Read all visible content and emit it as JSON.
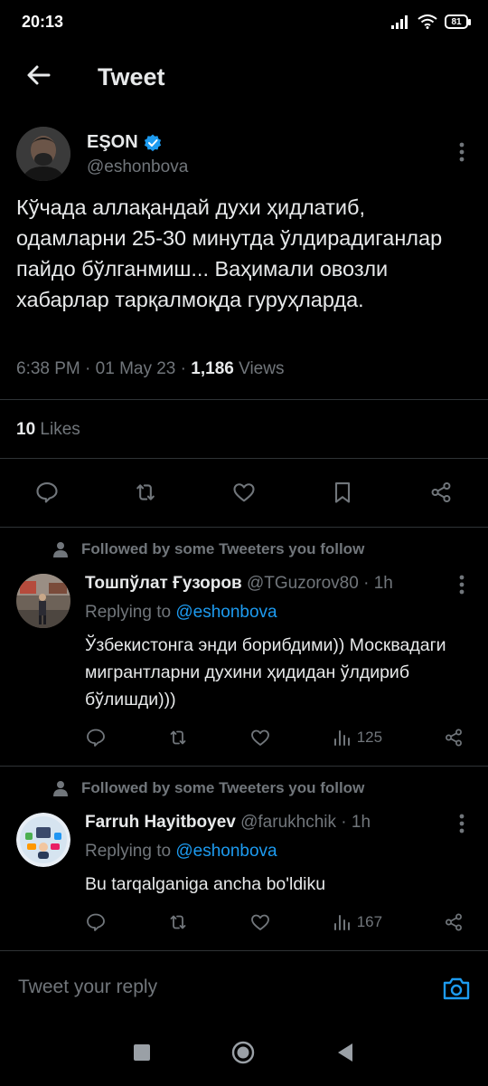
{
  "status_bar": {
    "time": "20:13",
    "battery": "81"
  },
  "header": {
    "title": "Tweet"
  },
  "tweet": {
    "author_name": "EŞON",
    "author_handle": "@eshonbova",
    "text": "Кўчада аллақандай духи ҳидлатиб, одамларни 25-30 минутда ўлдирадиганлар пайдо бўлганмиш... Ваҳимали овозли хабарлар тарқалмоқда гуруҳларда.",
    "time": "6:38 PM",
    "date": "01 May 23",
    "views_count": "1,186",
    "views_label": "Views",
    "likes_count": "10",
    "likes_label": "Likes"
  },
  "replies": [
    {
      "context": "Followed by some Tweeters you follow",
      "name": "Тошпўлат Ғузоров",
      "handle": "@TGuzorov80",
      "age": "1h",
      "replying_prefix": "Replying to",
      "replying_to": "@eshonbova",
      "text": "Ўзбекистонга энди борибдими)) Москвадаги мигрантларни духини ҳидидан ўлдириб бўлишди)))",
      "views": "125"
    },
    {
      "context": "Followed by some Tweeters you follow",
      "name": "Farruh Hayitboyev",
      "handle": "@farukhchik",
      "age": "1h",
      "replying_prefix": "Replying to",
      "replying_to": "@eshonbova",
      "text": "Bu tarqalganiga ancha bo'ldiku",
      "views": "167"
    }
  ],
  "composer": {
    "placeholder": "Tweet your reply"
  },
  "colors": {
    "background": "#000000",
    "text": "#e7e9ea",
    "muted": "#71767b",
    "accent": "#1d9bf0",
    "divider": "#2f3336"
  },
  "icons": {
    "status": [
      "signal-icon",
      "wifi-icon",
      "battery-icon"
    ],
    "actions": [
      "reply-icon",
      "retweet-icon",
      "like-icon",
      "bookmark-icon",
      "share-icon",
      "views-icon"
    ],
    "nav": [
      "recents-square-icon",
      "home-circle-icon",
      "back-triangle-icon"
    ]
  }
}
